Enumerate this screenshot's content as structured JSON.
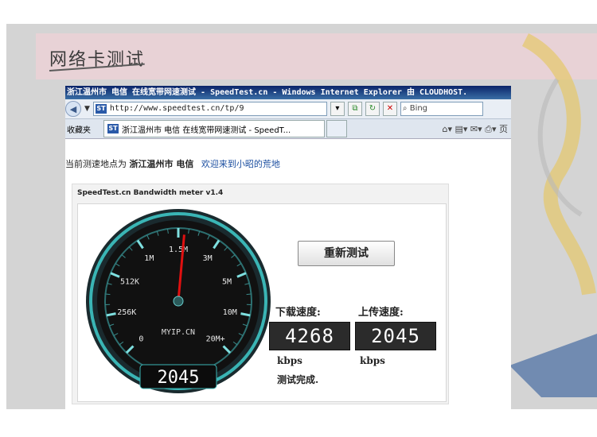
{
  "slide": {
    "title": "网络卡测试"
  },
  "browser": {
    "title_bar": "浙江温州市 电信 在线宽带网速测试 - SpeedTest.cn - Windows Internet Explorer 由 CLOUDHOST.",
    "favicon_label": "ST",
    "url": "http://www.speedtest.cn/tp/9",
    "search_placeholder": "Bing",
    "favorites_label": "收藏夹",
    "tab_title": "浙江温州市 电信 在线宽带网速测试 - SpeedT..."
  },
  "page": {
    "location_prefix": "当前测速地点为",
    "location": "浙江温州市 电信",
    "welcome_link": "欢迎来到小昭的荒地"
  },
  "widget": {
    "title": "SpeedTest.cn Bandwidth meter v1.4",
    "gauge": {
      "labels": [
        "0",
        "256K",
        "512K",
        "1M",
        "1.5M",
        "3M",
        "5M",
        "10M",
        "20M+"
      ],
      "brand": "MYIP.CN",
      "readout": "2045",
      "needle_label": "1.5M"
    },
    "retest_button": "重新测试",
    "download_label": "下载速度:",
    "upload_label": "上传速度:",
    "download_value": "4268",
    "upload_value": "2045",
    "unit": "kbps",
    "status": "测试完成."
  }
}
